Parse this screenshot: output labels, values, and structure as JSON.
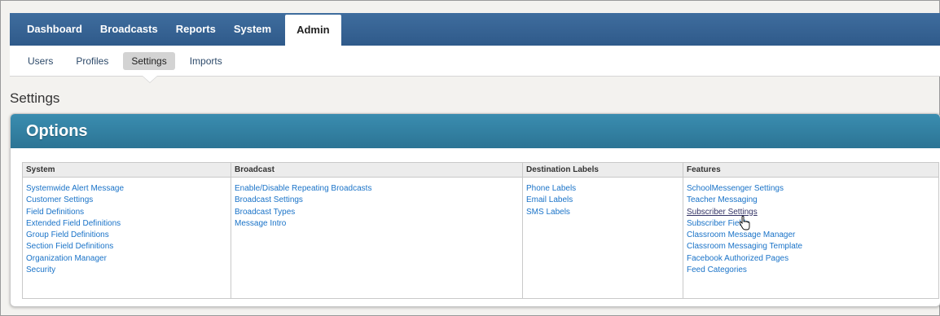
{
  "topnav": {
    "tabs": [
      {
        "label": "Dashboard"
      },
      {
        "label": "Broadcasts"
      },
      {
        "label": "Reports"
      },
      {
        "label": "System"
      },
      {
        "label": "Admin",
        "active": true
      }
    ]
  },
  "subnav": {
    "items": [
      {
        "label": "Users"
      },
      {
        "label": "Profiles"
      },
      {
        "label": "Settings",
        "active": true
      },
      {
        "label": "Imports"
      }
    ]
  },
  "page": {
    "title": "Settings"
  },
  "options": {
    "heading": "Options",
    "columns": [
      {
        "header": "System",
        "links": [
          "Systemwide Alert Message",
          "Customer Settings",
          "Field Definitions",
          "Extended Field Definitions",
          "Group Field Definitions",
          "Section Field Definitions",
          "Organization Manager",
          "Security"
        ]
      },
      {
        "header": "Broadcast",
        "links": [
          "Enable/Disable Repeating Broadcasts",
          "Broadcast Settings",
          "Broadcast Types",
          "Message Intro"
        ]
      },
      {
        "header": "Destination Labels",
        "links": [
          "Phone Labels",
          "Email Labels",
          "SMS Labels"
        ]
      },
      {
        "header": "Features",
        "links": [
          "SchoolMessenger Settings",
          "Teacher Messaging",
          "Subscriber Settings",
          "Subscriber Fields",
          "Classroom Message Manager",
          "Classroom Messaging Template",
          "Facebook Authorized Pages",
          "Feed Categories"
        ]
      }
    ],
    "hovered_link": "Subscriber Settings"
  },
  "colors": {
    "nav_bar": "#2f5a8a",
    "panel_header": "#2c7494",
    "link": "#1a73c8"
  },
  "icons": {
    "cursor": "hand-pointer-icon"
  }
}
